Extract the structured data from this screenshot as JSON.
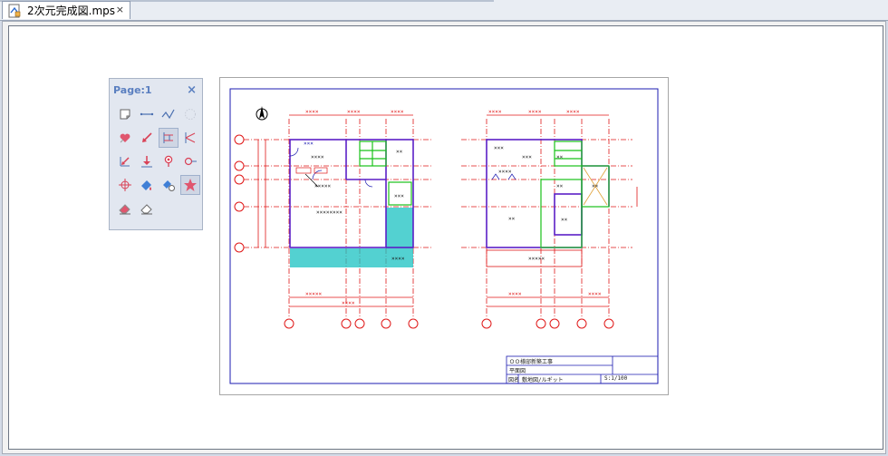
{
  "tab": {
    "title": "2次元完成図.mps",
    "close": "×"
  },
  "palette": {
    "title": "Page:1",
    "close": "×"
  },
  "drawing": {
    "dims": [
      "××××",
      "××××",
      "××××",
      "×××××",
      "××××",
      "××××",
      "××××",
      "××××",
      "××××",
      "××××"
    ],
    "rooms": [
      "×××",
      "××××",
      "×××××",
      "××××",
      "××××××××",
      "××××",
      "××",
      "×××",
      "××××",
      "×××",
      "×××",
      "××××",
      "×××××",
      "××",
      "××",
      "××",
      "××",
      "××"
    ],
    "grid_marks": [
      "⊗",
      "⊗",
      "⊗",
      "⊗",
      "⊗"
    ],
    "title_block": {
      "line1": "ＯＯ様邸新築工事",
      "line2": "平面図",
      "label": "図名",
      "name": "敷地図/ルギット",
      "scale": "S:1/100"
    }
  }
}
